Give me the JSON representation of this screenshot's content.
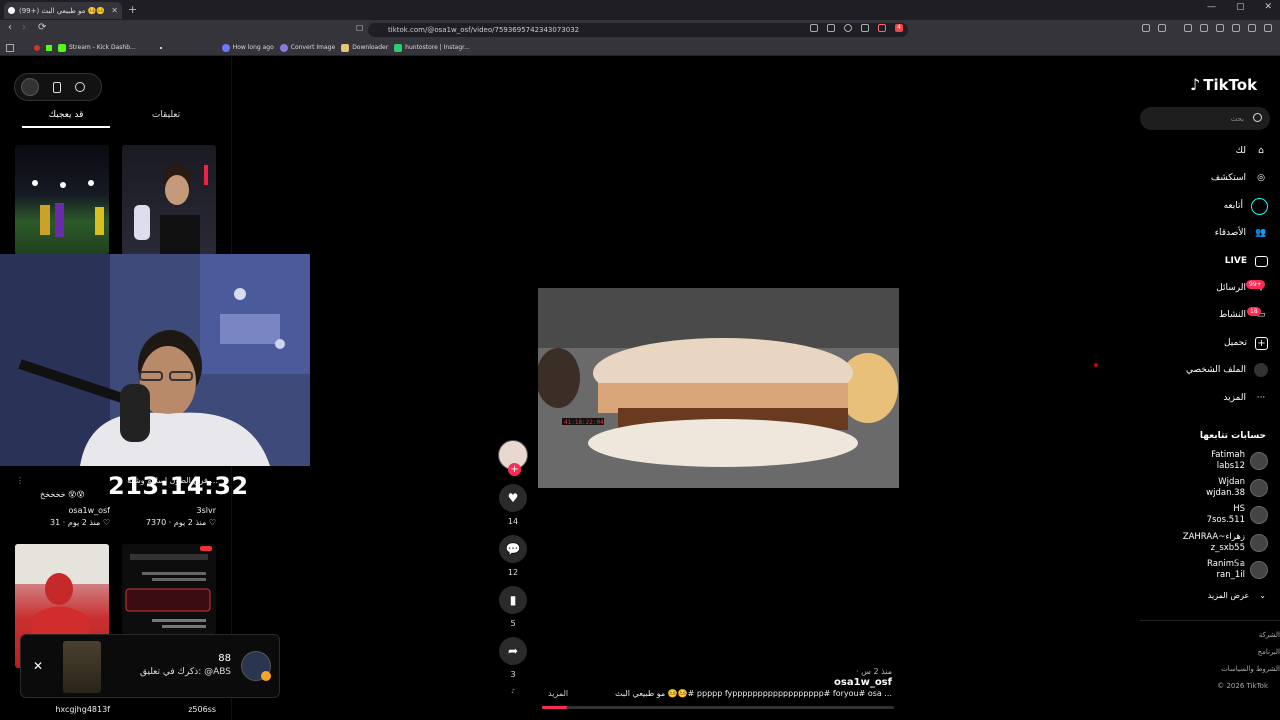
{
  "browser": {
    "tab_title": "(99+) مو طبيعي البث 🤒🤒 | TikTok",
    "url": "tiktok.com/@osa1w_osf/video/7593695742343073032",
    "new_tab": "+",
    "win_min": "—",
    "win_max": "▢",
    "win_close": "✕",
    "back": "‹",
    "forward": "›",
    "reload": "⟳",
    "bookmarks": [
      {
        "label": "Stream - Kick Dashb...",
        "color": "#53fc18"
      },
      {
        "label": "How long ago",
        "color": "#6b7bff"
      },
      {
        "label": "Convert Image",
        "color": "#8a7bd8"
      },
      {
        "label": "Downloader",
        "color": "#e6c27a"
      },
      {
        "label": "huntostore | Instagr...",
        "color": "#2ecc71"
      }
    ],
    "badge_count": "4"
  },
  "left_panel": {
    "tabs": [
      "قد يعجبك",
      "تعليقات"
    ],
    "cards": [
      {
        "caption": "فرق الطول اسامه وشله ...",
        "emoji": "😵",
        "user": "3slvr",
        "likes": "7370",
        "age": "منذ 2 يوم"
      },
      {
        "caption": "خخخخخ 😵😵",
        "user": "osa1w_osf",
        "likes": "31",
        "age": "منذ 2 يوم"
      },
      {
        "user": "z506ss"
      },
      {
        "user": "hxcgjhg4813f"
      }
    ],
    "timer": "213:14:32"
  },
  "notification": {
    "count": "88",
    "text": "ذكرك في تعليق: @ABS",
    "close": "✕"
  },
  "video": {
    "timestamp_overlay": "41:18:22:04",
    "likes": "14",
    "comments": "12",
    "saves": "5",
    "shares": "3",
    "user": "osa1w_osf",
    "age": "· منذ 2 س",
    "caption": "مو طبيعي البث 🤒🤒# ppppp fypppppppppppppppppp# foryou# osa ...",
    "more": "المزيد",
    "progress": 0.07
  },
  "right_panel": {
    "logo": "TikTok",
    "search_placeholder": "بحث",
    "nav": [
      {
        "label": "لك",
        "icon": "home-icon"
      },
      {
        "label": "استكشف",
        "icon": "compass-icon"
      },
      {
        "label": "أتابعه",
        "icon": "following-icon"
      },
      {
        "label": "الأصدقاء",
        "icon": "friends-icon"
      },
      {
        "label": "LIVE",
        "icon": "live-icon"
      },
      {
        "label": "الرسائل",
        "icon": "messages-icon",
        "badge": "99+"
      },
      {
        "label": "النشاط",
        "icon": "activity-icon",
        "badge": "18"
      },
      {
        "label": "تحميل",
        "icon": "upload-icon"
      },
      {
        "label": "الملف الشخصي",
        "icon": "profile-icon"
      },
      {
        "label": "المزيد",
        "icon": "more-icon"
      }
    ],
    "following_title": "حسابات تتابعها",
    "following": [
      {
        "name": "Fatimah",
        "handle": "labs12"
      },
      {
        "name": "Wjdan",
        "handle": "wjdan.38"
      },
      {
        "name": "HS",
        "handle": "7sos.511"
      },
      {
        "name": "ZAHRAA~زهراء",
        "handle": "z_sxb55"
      },
      {
        "name": "Ranim𝕊𝕒",
        "handle": "ran_1il"
      }
    ],
    "show_more": "عرض المزيد",
    "footer": [
      "الشركة",
      "البرنامج",
      "الشروط والسياسات",
      "© 2026 TikTok"
    ]
  }
}
